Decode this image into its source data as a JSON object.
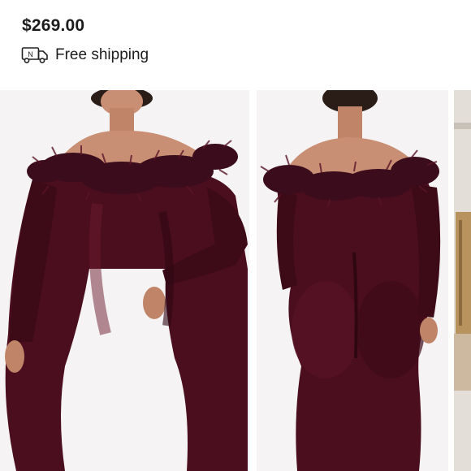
{
  "listing": {
    "price": "$269.00",
    "shipping_label": "Free shipping",
    "shipping_icon": "delivery-truck-icon",
    "truck_icon_letter": "N"
  },
  "gallery": {
    "photos": [
      {
        "name": "front-view",
        "garment_color": "#4a0e1e"
      },
      {
        "name": "back-view",
        "garment_color": "#4a0e1e"
      },
      {
        "name": "store-rack",
        "garment_color": "#b9935e"
      }
    ]
  }
}
